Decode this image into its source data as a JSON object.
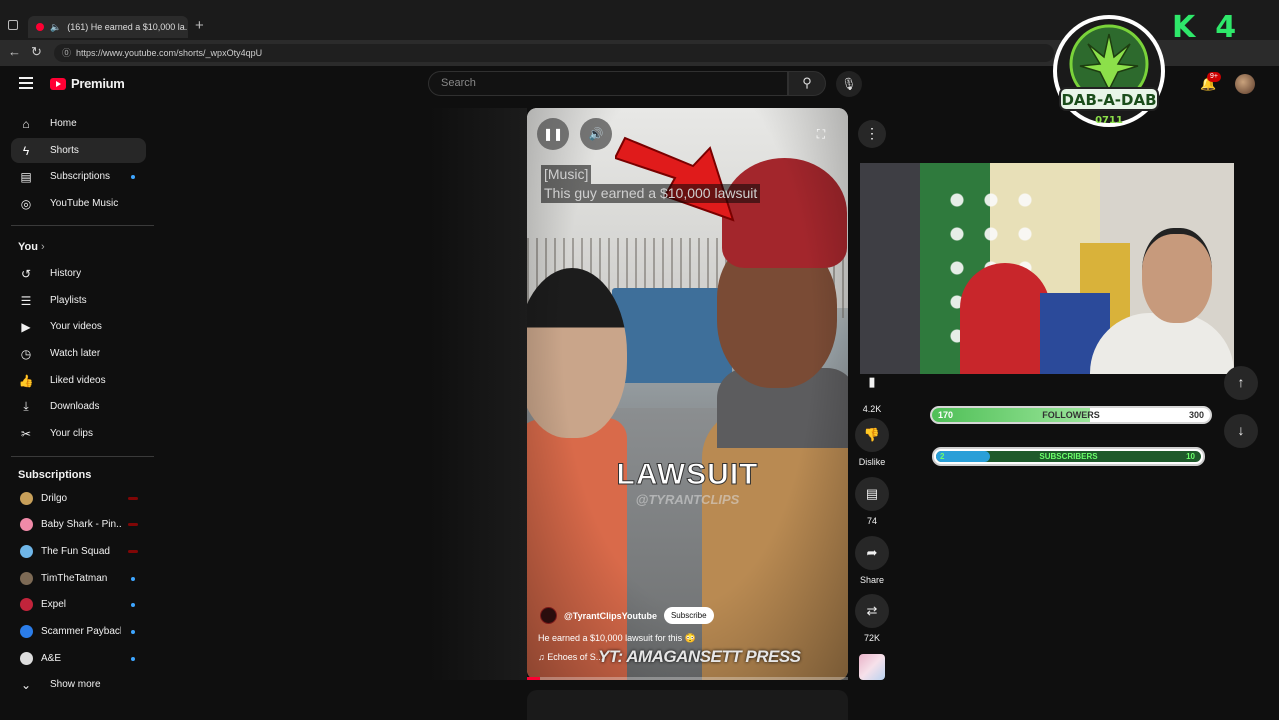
{
  "browser": {
    "tab_title": "(161) He earned a $10,000 la...",
    "url": "https://www.youtube.com/shorts/_wpxOty4qpU"
  },
  "header": {
    "brand": "Premium",
    "search_placeholder": "Search",
    "notification_count": "9+"
  },
  "sidebar": {
    "main": [
      {
        "label": "Home",
        "icon": "home-icon"
      },
      {
        "label": "Shorts",
        "icon": "shorts-icon"
      },
      {
        "label": "Subscriptions",
        "icon": "subscriptions-icon"
      },
      {
        "label": "YouTube Music",
        "icon": "music-icon"
      }
    ],
    "you_title": "You",
    "you": [
      {
        "label": "History"
      },
      {
        "label": "Playlists"
      },
      {
        "label": "Your videos"
      },
      {
        "label": "Watch later"
      },
      {
        "label": "Liked videos"
      },
      {
        "label": "Downloads"
      },
      {
        "label": "Your clips"
      }
    ],
    "subs_title": "Subscriptions",
    "subscriptions": [
      {
        "label": "Drilgo",
        "color": "#c8a05a"
      },
      {
        "label": "Baby Shark - Pin...",
        "color": "#f08aa8"
      },
      {
        "label": "The Fun Squad",
        "color": "#6fb6e8"
      },
      {
        "label": "TimTheTatman",
        "color": "#7d6a55"
      },
      {
        "label": "Expel",
        "color": "#c2243b"
      },
      {
        "label": "Scammer Payback",
        "color": "#2b7de9"
      },
      {
        "label": "A&E",
        "color": "#dddddd"
      }
    ],
    "show_more": "Show more"
  },
  "video": {
    "caption_line1": "[Music]",
    "caption_line2": "This guy earned a $10,000 lawsuit",
    "overlay_text": "LAWSUIT",
    "overlay_watermark": "@TYRANTCLIPS",
    "channel": "@TyrantClipsYoutube",
    "subscribe": "Subscribe",
    "title": "He earned a $10,000 lawsuit for this 😳",
    "music": "Echoes of S...",
    "press_watermark": "YT: AMAGANSETT PRESS",
    "progress": 0.04
  },
  "actions": {
    "likes": "4.2K",
    "dislike": "Dislike",
    "comments": "74",
    "share": "Share",
    "remix": "72K"
  },
  "stream_overlay": {
    "followers_label": "FOLLOWERS",
    "followers_current": "170",
    "followers_goal": "300",
    "followers_progress": 0.57,
    "subscribers_label": "SUBSCRIBERS",
    "subscribers_current": "2",
    "subscribers_goal": "10",
    "subscribers_progress": 0.2,
    "logo_text": "DAB-A-DAB",
    "logo_number": "0711",
    "corner_logo": "K4"
  },
  "colors": {
    "yt_red": "#ff0033",
    "green_fill": "#6bd46f",
    "blue_fill": "#2a9fd8"
  }
}
